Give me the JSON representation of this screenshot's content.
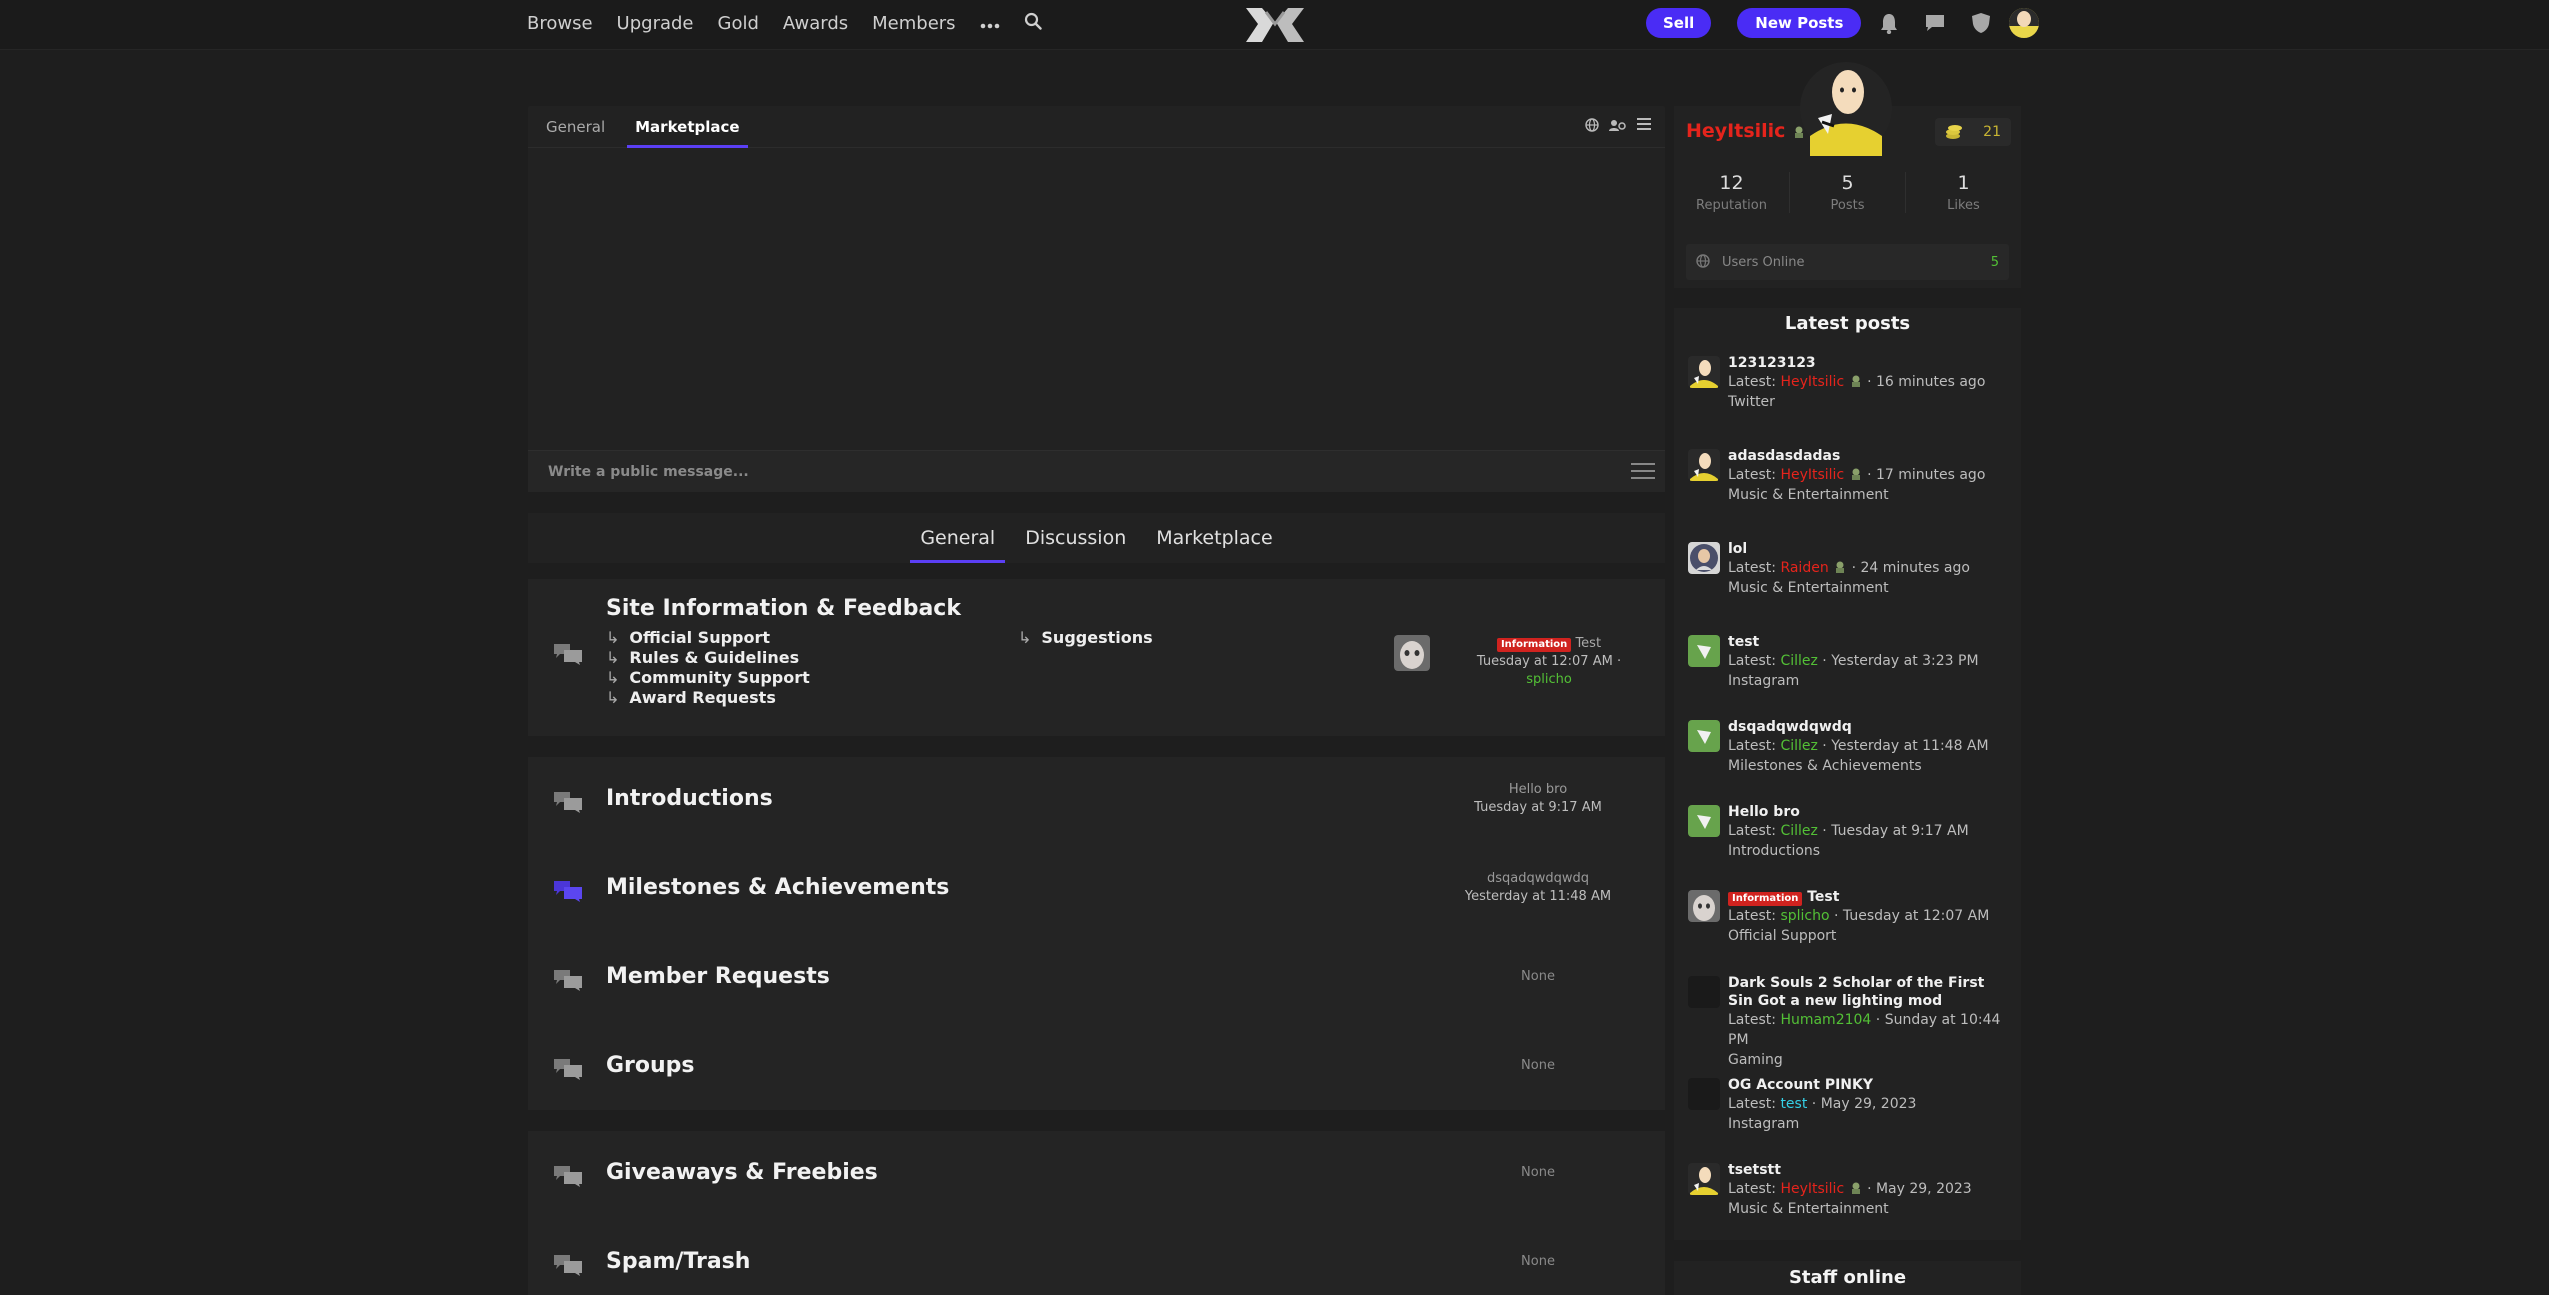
{
  "nav": {
    "links": [
      "Browse",
      "Upgrade",
      "Gold",
      "Awards",
      "Members"
    ],
    "more_icon": "ellipsis-icon",
    "search_icon": "search-icon",
    "sell_label": "Sell",
    "new_posts_label": "New Posts",
    "icons": [
      "bell-icon",
      "chat-bubble-icon",
      "shield-icon",
      "avatar"
    ]
  },
  "colors": {
    "accent": "#4a2cf5",
    "username_red": "#e5241c",
    "username_green": "#53c036",
    "username_cyan": "#35d0e6",
    "badge_red": "#d0231f"
  },
  "chat": {
    "tabs": [
      "General",
      "Marketplace"
    ],
    "active_tab": "Marketplace",
    "input_placeholder": "Write a public message..."
  },
  "forum_tabs": {
    "items": [
      "General",
      "Discussion",
      "Marketplace"
    ],
    "active": "General"
  },
  "nodes": {
    "site_info": {
      "title": "Site Information & Feedback",
      "subforums_left": [
        "Official Support",
        "Rules & Guidelines",
        "Community Support",
        "Award Requests"
      ],
      "subforums_right": [
        "Suggestions"
      ],
      "last_badge": "Information",
      "last_title": "Test",
      "last_time": "Tuesday at 12:07 AM",
      "last_separator": "·",
      "last_user": "splicho"
    },
    "introductions": {
      "title": "Introductions",
      "last_title": "Hello bro",
      "last_time": "Tuesday at 9:17 AM"
    },
    "milestones": {
      "title": "Milestones & Achievements",
      "last_title": "dsqadqwdqwdq",
      "last_time": "Yesterday at 11:48 AM"
    },
    "member_requests": {
      "title": "Member Requests",
      "last": "None"
    },
    "groups": {
      "title": "Groups",
      "last": "None"
    },
    "giveaways": {
      "title": "Giveaways & Freebies",
      "last": "None"
    },
    "spam": {
      "title": "Spam/Trash",
      "last": "None"
    }
  },
  "profile": {
    "username": "HeyItsilic",
    "coins": "21",
    "stats": [
      {
        "value": "12",
        "label": "Reputation"
      },
      {
        "value": "5",
        "label": "Posts"
      },
      {
        "value": "1",
        "label": "Likes"
      }
    ],
    "online_label": "Users Online",
    "online_count": "5"
  },
  "latest_posts": {
    "heading": "Latest posts",
    "latest_prefix": "Latest:",
    "separator": "·",
    "items": [
      {
        "title": "123123123",
        "user": "HeyItsilic",
        "user_color": "red",
        "time": "16 minutes ago",
        "forum": "Twitter",
        "avatar": "yellow-hero"
      },
      {
        "title": "adasdasdadas",
        "user": "HeyItsilic",
        "user_color": "red",
        "time": "17 minutes ago",
        "forum": "Music & Entertainment",
        "avatar": "yellow-hero"
      },
      {
        "title": "lol",
        "user": "Raiden",
        "user_color": "red",
        "time": "24 minutes ago",
        "forum": "Music & Entertainment",
        "avatar": "portrait"
      },
      {
        "title": "test",
        "user": "Cillez",
        "user_color": "green",
        "time": "Yesterday at 3:23 PM",
        "forum": "Instagram",
        "avatar": "green"
      },
      {
        "title": "dsqadqwdqwdq",
        "user": "Cillez",
        "user_color": "green",
        "time": "Yesterday at 11:48 AM",
        "forum": "Milestones & Achievements",
        "avatar": "green"
      },
      {
        "title": "Hello bro",
        "user": "Cillez",
        "user_color": "green",
        "time": "Tuesday at 9:17 AM",
        "forum": "Introductions",
        "avatar": "green"
      },
      {
        "title": "Test",
        "badge": "Information",
        "user": "splicho",
        "user_color": "green",
        "time": "Tuesday at 12:07 AM",
        "forum": "Official Support",
        "avatar": "face"
      },
      {
        "title": "Dark Souls 2 Scholar of the First Sin Got a new lighting mod",
        "user": "Humam2104",
        "user_color": "green",
        "time": "Sunday at 10:44 PM",
        "forum": "Gaming",
        "avatar": "dark"
      },
      {
        "title": "OG Account PINKY",
        "user": "test",
        "user_color": "cyan",
        "time": "May 29, 2023",
        "forum": "Instagram",
        "avatar": "dark"
      },
      {
        "title": "tsetstt",
        "user": "HeyItsilic",
        "user_color": "red",
        "time": "May 29, 2023",
        "forum": "Music & Entertainment",
        "avatar": "yellow-hero"
      }
    ]
  },
  "staff": {
    "heading": "Staff online"
  }
}
